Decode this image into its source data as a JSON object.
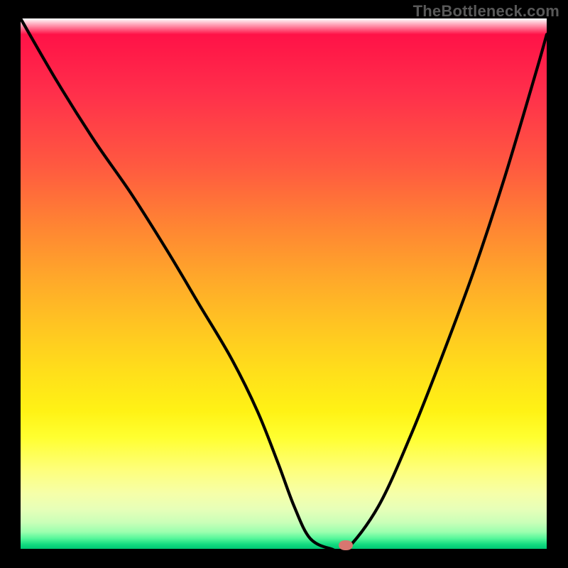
{
  "watermark": "TheBottleneck.com",
  "chart_data": {
    "type": "line",
    "title": "",
    "xlabel": "",
    "ylabel": "",
    "xlim": [
      0,
      100
    ],
    "ylim": [
      0,
      100
    ],
    "series": [
      {
        "name": "curve",
        "x": [
          0,
          7,
          14,
          21,
          28,
          34,
          40,
          45,
          49,
          52,
          55,
          59,
          62,
          68,
          74,
          80,
          86,
          92,
          98,
          100
        ],
        "y": [
          100,
          88,
          77,
          67,
          56,
          46,
          36,
          26,
          16,
          8,
          2,
          0,
          0,
          8,
          21,
          36,
          52,
          70,
          90,
          97
        ]
      }
    ],
    "marker": {
      "x": 61.8,
      "y": 0.7
    },
    "colors": {
      "curve": "#000000",
      "marker": "#d87670",
      "gradient_top": "#ff1247",
      "gradient_bottom": "#00c673"
    }
  }
}
